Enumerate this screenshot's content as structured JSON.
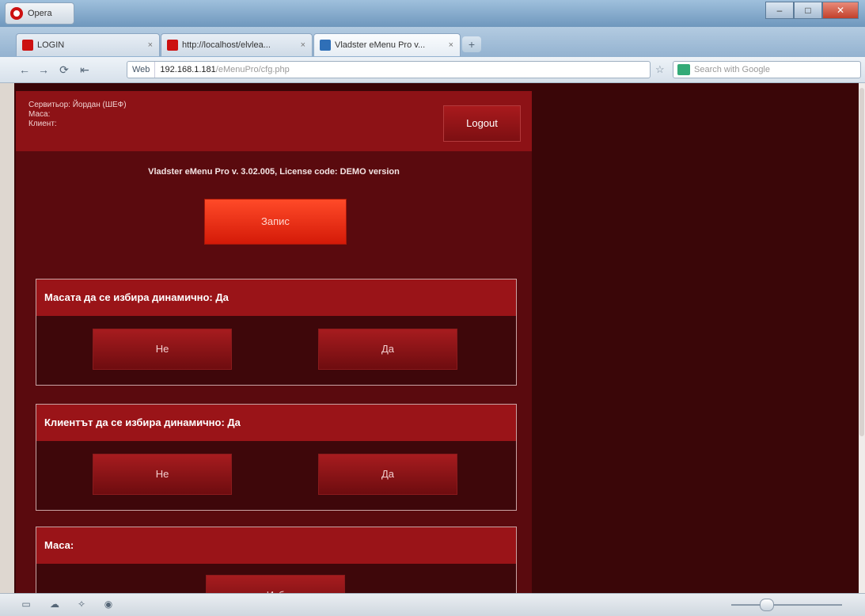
{
  "browser": {
    "menu_label": "Opera",
    "tabs": [
      {
        "label": "LOGIN",
        "close": "×"
      },
      {
        "label": "http://localhost/elvlea...",
        "close": "×"
      },
      {
        "label": "Vladster eMenu Pro v...",
        "close": "×"
      }
    ],
    "new_tab": "+",
    "address_web": "Web",
    "address_url_main": "192.168.1.181",
    "address_url_rest": "/eMenuPro/cfg.php",
    "search_placeholder": "Search with Google",
    "win_min": "–",
    "win_max": "□",
    "win_close": "✕"
  },
  "app": {
    "header": {
      "line1": "Сервитьор: Йордан (ШЕФ)",
      "line2": "Маса:",
      "line3": "Клиент:",
      "logout": "Logout"
    },
    "license": "Vladster eMenu Pro v. 3.02.005, License code: DEMO version",
    "save": "Запис",
    "panels": [
      {
        "title": "Масата да се избира динамично: Да",
        "btn_no": "Не",
        "btn_yes": "Да"
      },
      {
        "title": "Клиентът да се избира динамично: Да",
        "btn_no": "Не",
        "btn_yes": "Да"
      },
      {
        "title": "Маса:",
        "btn_choose": "Изб"
      }
    ]
  },
  "colors": {
    "header_bg": "#8d1216",
    "app_bg": "#5a0a0e",
    "save_btn": "#ff3a1a",
    "panel_head": "#9a1418"
  }
}
